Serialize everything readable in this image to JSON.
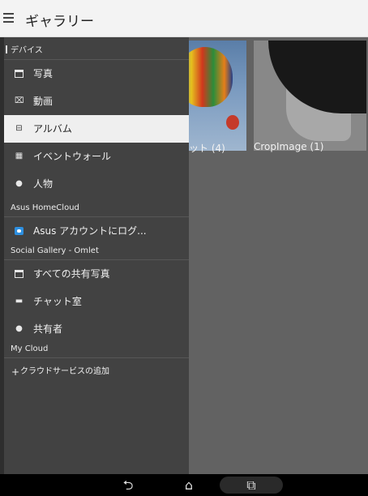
{
  "header": {
    "title": "ギャラリー",
    "menu_icon": "menu-icon"
  },
  "albums": [
    {
      "label": "ット (4)"
    },
    {
      "label": "CropImage (1)"
    }
  ],
  "drawer": {
    "sections": [
      {
        "title": "デバイス"
      },
      {
        "title": "Asus HomeCloud"
      },
      {
        "title": "Social Gallery - Omlet"
      },
      {
        "title": "My Cloud"
      }
    ],
    "device_items": [
      {
        "label": "写真",
        "icon": "photo-icon"
      },
      {
        "label": "動画",
        "icon": "video-icon"
      },
      {
        "label": "アルバム",
        "icon": "album-icon",
        "selected": true
      },
      {
        "label": "イベントウォール",
        "icon": "calendar-icon"
      },
      {
        "label": "人物",
        "icon": "person-icon"
      }
    ],
    "homecloud_items": [
      {
        "label": "Asus アカウントにログ...",
        "icon": "cloud-icon"
      }
    ],
    "omlet_items": [
      {
        "label": "すべての共有写真",
        "icon": "shared-photos-icon"
      },
      {
        "label": "チャット室",
        "icon": "chat-icon"
      },
      {
        "label": "共有者",
        "icon": "people-icon"
      }
    ],
    "mycloud_items": [
      {
        "label": "クラウドサービスの追加",
        "icon": "plus-icon"
      }
    ]
  },
  "navbar": {
    "back": "back-icon",
    "home": "home-icon",
    "recents": "recents-icon"
  },
  "colors": {
    "drawer_bg": "#424242",
    "selected_bg": "#efefef",
    "accent_cloud": "#2d8fe0"
  }
}
